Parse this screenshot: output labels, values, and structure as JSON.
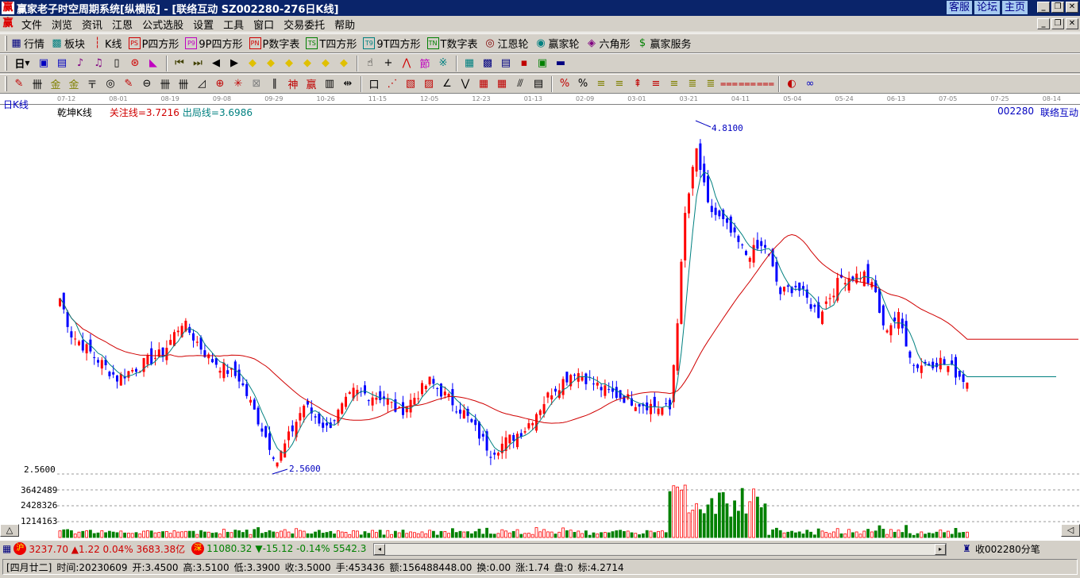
{
  "title": {
    "app": "赢家老子时空周期系统[纵横版] - [联络互动   SZ002280-276日K线]",
    "links": [
      "客服",
      "论坛",
      "主页"
    ]
  },
  "menu": [
    "文件",
    "浏览",
    "资讯",
    "江恩",
    "公式选股",
    "设置",
    "工具",
    "窗口",
    "交易委托",
    "帮助"
  ],
  "toolbar1": [
    {
      "label": "行情",
      "icon": "grid-icon",
      "glyph": "▦",
      "color": "#000080"
    },
    {
      "label": "板块",
      "icon": "blocks-icon",
      "glyph": "▩",
      "color": "#008080"
    },
    {
      "label": "K线",
      "icon": "kline-icon",
      "glyph": "┆",
      "color": "#d00000"
    },
    {
      "label": "P四方形",
      "icon": "ps-icon",
      "glyph": "PS",
      "color": "#d00000"
    },
    {
      "label": "9P四方形",
      "icon": "p9-icon",
      "glyph": "P9",
      "color": "#c000c0"
    },
    {
      "label": "P数字表",
      "icon": "pn-icon",
      "glyph": "PN",
      "color": "#d00000"
    },
    {
      "label": "T四方形",
      "icon": "ts-icon",
      "glyph": "TS",
      "color": "#008000"
    },
    {
      "label": "9T四方形",
      "icon": "t9-icon",
      "glyph": "T9",
      "color": "#008080"
    },
    {
      "label": "T数字表",
      "icon": "tn-icon",
      "glyph": "TN",
      "color": "#008000"
    },
    {
      "label": "江恩轮",
      "icon": "gann-wheel-icon",
      "glyph": "◎",
      "color": "#800000"
    },
    {
      "label": "赢家轮",
      "icon": "winner-wheel-icon",
      "glyph": "◉",
      "color": "#008080"
    },
    {
      "label": "六角形",
      "icon": "hexagon-icon",
      "glyph": "◈",
      "color": "#800080"
    },
    {
      "label": "赢家服务",
      "icon": "dollar-icon",
      "glyph": "$",
      "color": "#008000"
    }
  ],
  "period_label": "日",
  "toolbar2": [
    {
      "icon": "chart-style-icon",
      "glyph": "▣",
      "color": "#0000c0"
    },
    {
      "icon": "note-icon",
      "glyph": "▤",
      "color": "#0000c0"
    },
    {
      "icon": "indicator3-icon",
      "glyph": "♪",
      "color": "#800080"
    },
    {
      "icon": "indicator9-icon",
      "glyph": "♫",
      "color": "#800080"
    },
    {
      "icon": "candle-dropdown-icon",
      "glyph": "▯",
      "color": "#000"
    },
    {
      "icon": "cycle-icon",
      "glyph": "⊛",
      "color": "#d00000"
    },
    {
      "icon": "flag-icon",
      "glyph": "◣",
      "color": "#c000c0"
    },
    {
      "icon": "first-icon",
      "glyph": "⏮",
      "color": "#404000"
    },
    {
      "icon": "last-icon",
      "glyph": "⏭",
      "color": "#404000"
    },
    {
      "icon": "prev-icon",
      "glyph": "◀",
      "color": "#000"
    },
    {
      "icon": "next-icon",
      "glyph": "▶",
      "color": "#000"
    },
    {
      "icon": "move-left-icon",
      "glyph": "◆",
      "color": "#e0c000"
    },
    {
      "icon": "move-right-icon",
      "glyph": "◆",
      "color": "#e0c000"
    },
    {
      "icon": "expand-icon",
      "glyph": "◆",
      "color": "#e0c000"
    },
    {
      "icon": "shrink-icon",
      "glyph": "◆",
      "color": "#e0c000"
    },
    {
      "icon": "zoom-in-icon",
      "glyph": "◆",
      "color": "#e0c000"
    },
    {
      "icon": "zoom-out-icon",
      "glyph": "◆",
      "color": "#e0c000"
    },
    {
      "icon": "hand-icon",
      "glyph": "☝",
      "color": "#000"
    },
    {
      "icon": "crosshair-icon",
      "glyph": "+",
      "color": "#000"
    },
    {
      "icon": "wave-icon",
      "glyph": "⋀",
      "color": "#d00000"
    },
    {
      "icon": "section-icon",
      "glyph": "節",
      "color": "#c000c0"
    },
    {
      "icon": "pattern-icon",
      "glyph": "※",
      "color": "#008080"
    },
    {
      "icon": "calendar-icon",
      "glyph": "▦",
      "color": "#008080"
    },
    {
      "icon": "calculator-icon",
      "glyph": "▩",
      "color": "#000080"
    },
    {
      "icon": "report-icon",
      "glyph": "▤",
      "color": "#000080"
    },
    {
      "icon": "save-icon",
      "glyph": "▪",
      "color": "#c00000"
    },
    {
      "icon": "export-icon",
      "glyph": "▣",
      "color": "#008000"
    },
    {
      "icon": "truck-icon",
      "glyph": "▬",
      "color": "#000080"
    }
  ],
  "toolbar3": [
    "pen-icon",
    "parallel-lines-icon",
    "gold-line-icon",
    "gold-line2-icon",
    "fib-line-icon",
    "spiral-icon",
    "fan-pen-icon",
    "circle-grid-icon",
    "vertical-lines-icon",
    "n2-lines-icon",
    "angle-icon",
    "target-icon",
    "radial-icon",
    "square-spiral-icon",
    "slash-lines-icon",
    "shen-icon",
    "ying-icon",
    "cycle-bars-icon",
    "measure-icon",
    "box-icon",
    "fan-icon",
    "gann-box-icon",
    "gann-square-icon",
    "angle2-icon",
    "zigzag-icon",
    "grid-icon",
    "grid2-icon",
    "channel-icon",
    "ruler-icon",
    "percent-icon",
    "percent2-icon",
    "gold-ratio-icon",
    "gold-ratio2-icon",
    "arrow-icon",
    "levels-icon",
    "gold-levels-icon",
    "tri-lines-icon",
    "gold-tri-icon",
    "speed-lines-icon",
    "speed-lines2-icon",
    "speed-lines3-icon",
    "color-wheel-icon",
    "infinity-icon"
  ],
  "chart": {
    "period": "日K线",
    "indicator": "乾坤K线",
    "attention_line": "关注线=3.7216",
    "exit_line": "出局线=3.6986",
    "code": "002280",
    "name": "联络互动",
    "dates": [
      "07-12",
      "08-01",
      "08-19",
      "09-08",
      "09-29",
      "10-26",
      "11-15",
      "12-05",
      "12-23",
      "01-13",
      "02-09",
      "03-01",
      "03-21",
      "04-11",
      "05-04",
      "05-24",
      "06-13",
      "07-05",
      "07-25",
      "08-14"
    ],
    "high_label": "4.8100",
    "low_label": "2.5600",
    "price_axis_label": "2.5600",
    "volume_axis": [
      "3642489",
      "2428326",
      "1214163"
    ],
    "colors": {
      "up": "#ff0000",
      "down": "#0000ff",
      "ma_short": "#008080",
      "ma_long": "#d00000",
      "vol_up": "#ff0000",
      "vol_down": "#008000"
    }
  },
  "chart_data": {
    "type": "candlestick",
    "price_range": [
      2.56,
      4.81
    ],
    "volume_max": 3642489,
    "close_keypoints": [
      [
        0,
        3.68
      ],
      [
        3,
        3.45
      ],
      [
        15,
        3.17
      ],
      [
        27,
        3.33
      ],
      [
        32,
        3.53
      ],
      [
        39,
        3.3
      ],
      [
        47,
        3.17
      ],
      [
        57,
        2.64
      ],
      [
        64,
        3.0
      ],
      [
        70,
        2.85
      ],
      [
        77,
        3.08
      ],
      [
        85,
        3.05
      ],
      [
        89,
        2.95
      ],
      [
        97,
        3.15
      ],
      [
        106,
        2.95
      ],
      [
        113,
        2.7
      ],
      [
        122,
        2.85
      ],
      [
        129,
        3.09
      ],
      [
        135,
        3.22
      ],
      [
        143,
        3.09
      ],
      [
        151,
        3.02
      ],
      [
        160,
        2.97
      ],
      [
        162,
        3.55
      ],
      [
        164,
        4.21
      ],
      [
        167,
        4.62
      ],
      [
        170,
        4.26
      ],
      [
        174,
        4.16
      ],
      [
        180,
        3.96
      ],
      [
        185,
        4.01
      ],
      [
        189,
        3.71
      ],
      [
        193,
        3.76
      ],
      [
        199,
        3.58
      ],
      [
        205,
        3.81
      ],
      [
        211,
        3.83
      ],
      [
        214,
        3.71
      ],
      [
        216,
        3.48
      ],
      [
        220,
        3.56
      ],
      [
        224,
        3.25
      ],
      [
        231,
        3.28
      ],
      [
        238,
        3.15
      ]
    ],
    "ma_periods": [
      5,
      30
    ]
  },
  "status": {
    "sh_badge": "沪",
    "sh": "3237.70 ▲1.22 0.04% 3683.38亿",
    "sz_badge": "深",
    "sz_value": "11080.32",
    "sz_change": "▼-15.12 -0.14% 5542.3",
    "stock_btn": "收002280分笔"
  },
  "bottom": {
    "lunar": "[四月廿二]",
    "time": "时间:20230609",
    "open": "开:3.4500",
    "high": "高:3.5100",
    "low": "低:3.3900",
    "close": "收:3.5000",
    "hand": "手:453436",
    "amount": "额:156488448.00",
    "turnover": "换:0.00",
    "rise": "涨:1.74",
    "pan": "盘:0",
    "biao": "标:4.2714"
  }
}
